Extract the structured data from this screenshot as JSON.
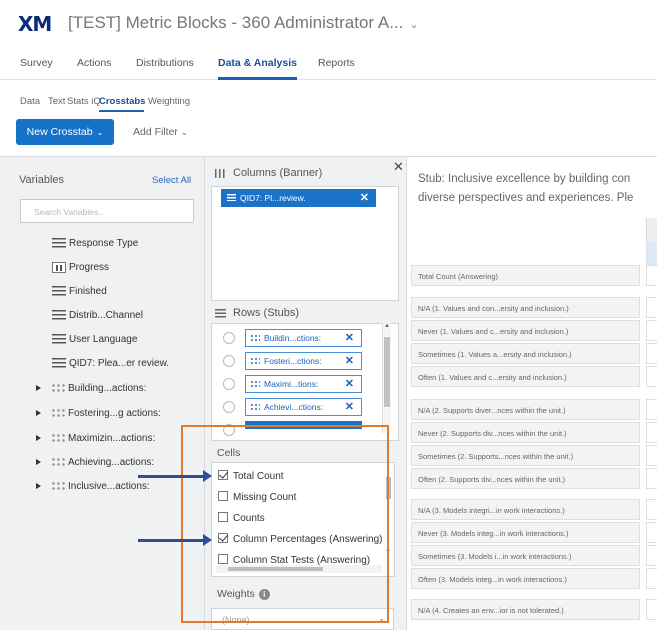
{
  "header": {
    "logo": "XM",
    "project_title": "[TEST] Metric Blocks - 360 Administrator A...",
    "title_caret": "⌄"
  },
  "nav": {
    "tabs": [
      "Survey",
      "Actions",
      "Distributions",
      "Data & Analysis",
      "Reports"
    ],
    "active": "Data & Analysis"
  },
  "subnav": {
    "tabs": [
      "Data",
      "Text",
      "Stats iQ",
      "Crosstabs",
      "Weighting"
    ],
    "active": "Crosstabs"
  },
  "toolbar": {
    "new_crosstab": "New Crosstab",
    "add_filter": "Add Filter",
    "caret": "⌄"
  },
  "variables": {
    "title": "Variables",
    "select_all": "Select All",
    "search_placeholder": "Search Variables...",
    "items": [
      {
        "label": "Response Type",
        "icon": "lines-icon"
      },
      {
        "label": "Progress",
        "icon": "bar-chart-icon"
      },
      {
        "label": "Finished",
        "icon": "lines-icon"
      },
      {
        "label": "Distrib...Channel",
        "icon": "lines-icon"
      },
      {
        "label": "User Language",
        "icon": "lines-icon"
      },
      {
        "label": "QID7: Plea...er review.",
        "icon": "lines-icon"
      },
      {
        "label": "Building...actions:",
        "icon": "matrix-icon"
      },
      {
        "label": "Fostering...g actions:",
        "icon": "matrix-icon"
      },
      {
        "label": "Maximizin...actions:",
        "icon": "matrix-icon"
      },
      {
        "label": "Achieving...actions:",
        "icon": "matrix-icon"
      },
      {
        "label": "Inclusive...actions:",
        "icon": "matrix-icon"
      }
    ]
  },
  "columns": {
    "title": "Columns (Banner)",
    "chip": "QID7: Pl...review.",
    "close": "✕"
  },
  "rows": {
    "title": "Rows (Stubs)",
    "chips": [
      "Buildin...ctions:",
      "Fosteri...ctions:",
      "Maximi...tions:",
      "Achievi...ctions:"
    ],
    "remove": "✕"
  },
  "cells": {
    "title": "Cells",
    "options": [
      {
        "label": "Total Count",
        "checked": true
      },
      {
        "label": "Missing Count",
        "checked": false
      },
      {
        "label": "Counts",
        "checked": false
      },
      {
        "label": "Column Percentages (Answering)",
        "checked": true
      },
      {
        "label": "Column Stat Tests (Answering)",
        "checked": false
      }
    ]
  },
  "weights": {
    "title": "Weights",
    "info": "i",
    "value": "(None)"
  },
  "table": {
    "stub_line1": "Stub: Inclusive excellence by building con",
    "stub_line2": "diverse perspectives and experiences. Ple",
    "rows": [
      "Total Count (Answering)",
      "N/A (1. Values and con...ersity and inclusion.)",
      "Never (1. Values and c...ersity and inclusion.)",
      "Sometimes (1. Values a...ersity and inclusion.)",
      "Often (1. Values and c...ersity and inclusion.)",
      "N/A (2. Supports diver...nces within the unit.)",
      "Never (2. Supports div...nces within the unit.)",
      "Sometimes (2. Supports...nces within the unit.)",
      "Often (2. Supports div...nces within the unit.)",
      "N/A (3. Models integri...in work interactions.)",
      "Never (3. Models integ...in work interactions.)",
      "Sometimes (3. Models i...in work interactions.)",
      "Often (3. Models integ...in work interactions.)",
      "N/A (4. Creates an env...ior is not tolerated.)"
    ]
  },
  "colors": {
    "accent": "#1473c8",
    "annotation_box": "#e07a2d",
    "annotation_arrow": "#2e4f92"
  }
}
